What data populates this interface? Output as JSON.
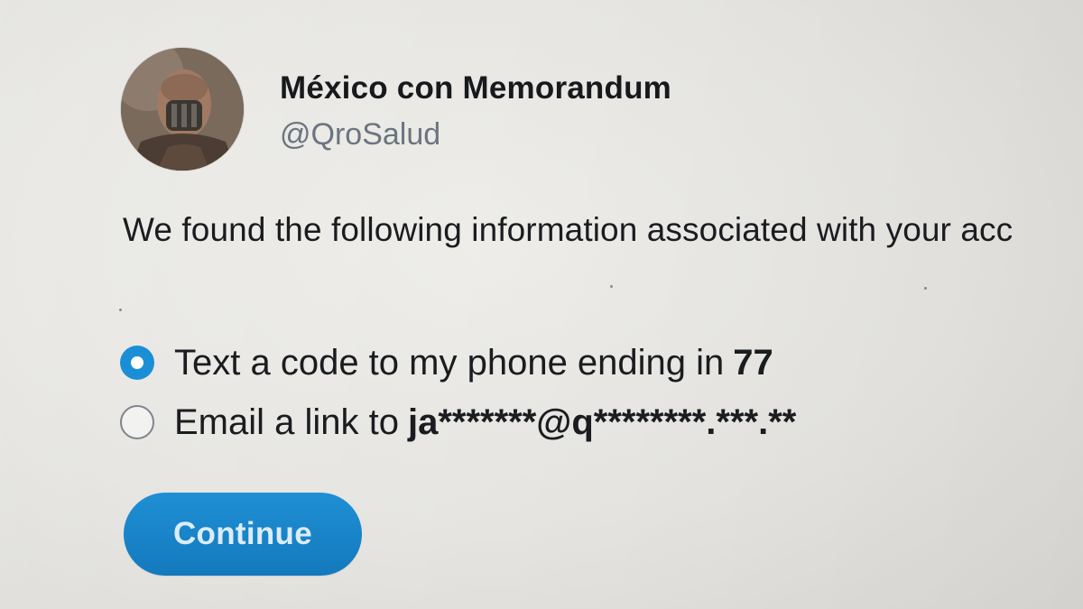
{
  "profile": {
    "display_name": "México con Memorandum",
    "handle": "@QroSalud",
    "avatar_icon": "profile-photo"
  },
  "message": "We found the following information associated with your acc",
  "options": [
    {
      "label": "Text a code to my phone ending in",
      "value": "77",
      "selected": true
    },
    {
      "label": "Email a link to",
      "value": "ja*******@q********.***.**",
      "selected": false
    }
  ],
  "continue_label": "Continue",
  "colors": {
    "accent": "#1b8fd6",
    "button": "#1a84c9",
    "handle": "#6b7580",
    "background": "#e9e8e4"
  }
}
